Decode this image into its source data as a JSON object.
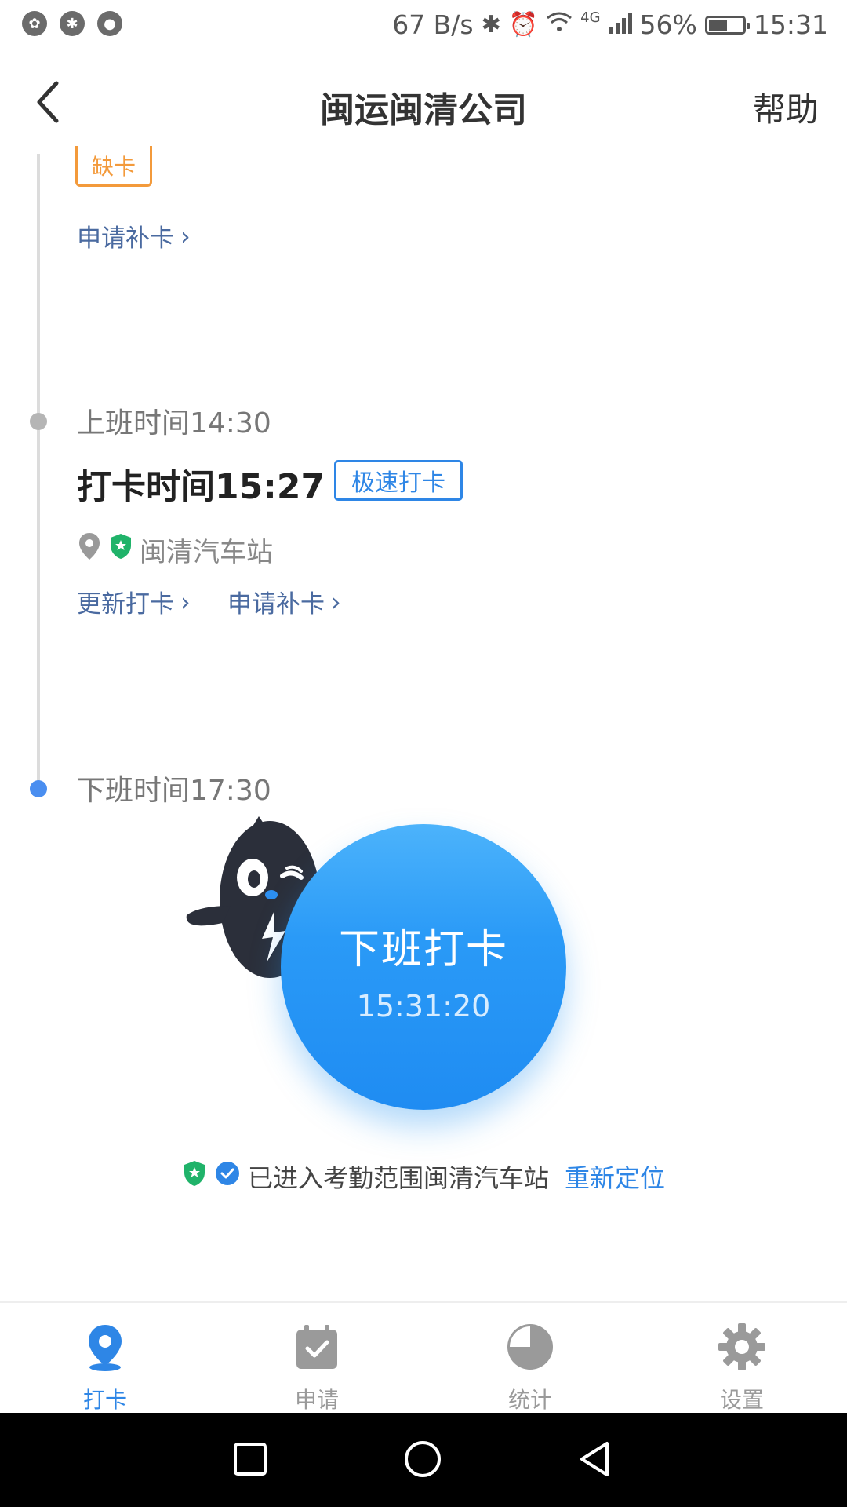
{
  "status_bar": {
    "speed": "67 B/s",
    "network": "4G",
    "battery": "56%",
    "battery_level": 0.56,
    "time": "15:31"
  },
  "header": {
    "title": "闽运闽清公司",
    "help_label": "帮助"
  },
  "record_prev": {
    "tag": "缺卡",
    "apply_link": "申请补卡"
  },
  "record_on": {
    "shift_label": "上班时间14:30",
    "punch_time": "打卡时间15:27",
    "tag": "极速打卡",
    "location": "闽清汽车站",
    "update_link": "更新打卡",
    "apply_link": "申请补卡"
  },
  "record_off": {
    "shift_label": "下班时间17:30"
  },
  "clock_button": {
    "label": "下班打卡",
    "time": "15:31:20"
  },
  "range_info": {
    "text": "已进入考勤范围闽清汽车站",
    "relocate": "重新定位"
  },
  "tabbar": {
    "tabs": [
      {
        "label": "打卡",
        "icon": "location-pin-icon",
        "active": true
      },
      {
        "label": "申请",
        "icon": "calendar-check-icon",
        "active": false
      },
      {
        "label": "统计",
        "icon": "pie-chart-icon",
        "active": false
      },
      {
        "label": "设置",
        "icon": "gear-icon",
        "active": false
      }
    ]
  },
  "colors": {
    "accent": "#2e86e6",
    "warning": "#f39a3b",
    "link": "#4a6aa0"
  }
}
